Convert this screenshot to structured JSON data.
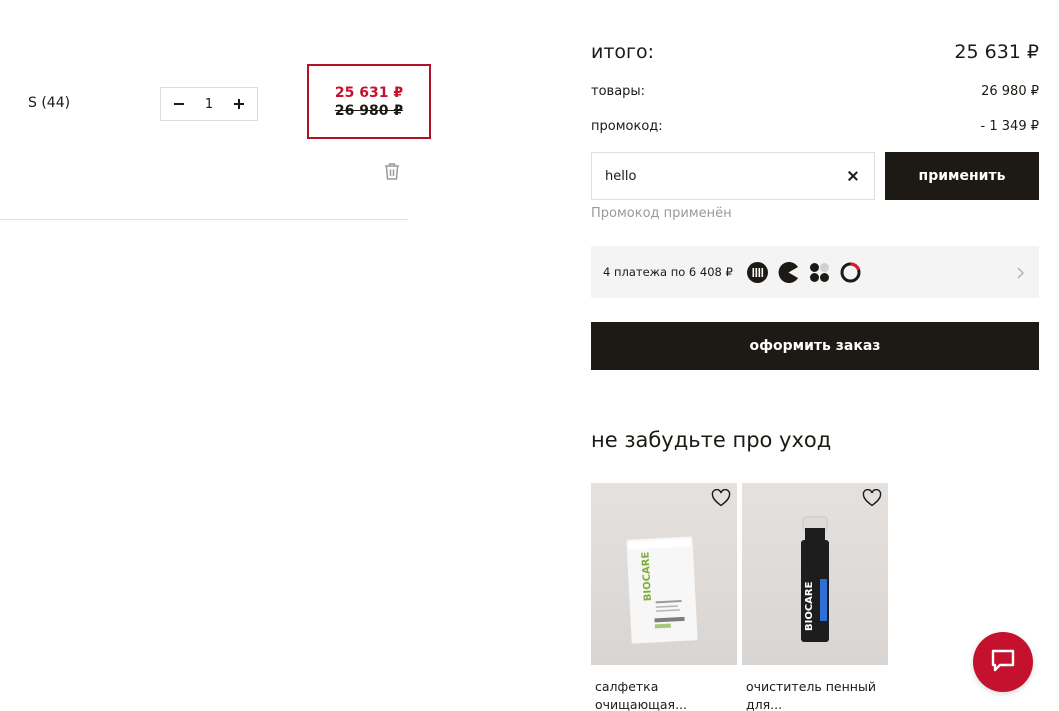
{
  "cart_item": {
    "size": "S (44)",
    "quantity": "1",
    "price_current": "25 631 ₽",
    "price_old": "26 980 ₽"
  },
  "summary": {
    "total_label": "итого:",
    "total_value": "25 631 ₽",
    "goods_label": "товары:",
    "goods_value": "26 980 ₽",
    "promo_label": "промокод:",
    "promo_value": "- 1 349 ₽"
  },
  "promo": {
    "input_value": "hello",
    "apply_label": "применить",
    "status": "Промокод применён"
  },
  "installments": {
    "text": "4 платежа по 6 408 ₽",
    "icons": [
      "split-pay-icon",
      "pacman-pay-icon",
      "dots-pay-icon",
      "ring-pay-icon"
    ]
  },
  "checkout": {
    "label": "оформить заказ"
  },
  "care": {
    "title": "не забудьте про уход",
    "products": [
      {
        "name": "салфетка очищающая...",
        "brand": "BIOCARE"
      },
      {
        "name": "очиститель пенный для...",
        "brand": "BIOCARE"
      }
    ]
  },
  "colors": {
    "accent_red": "#c4122e",
    "dark": "#1d1a15",
    "muted_gray": "#9a9a9a",
    "panel_bg": "#f4f4f4"
  }
}
